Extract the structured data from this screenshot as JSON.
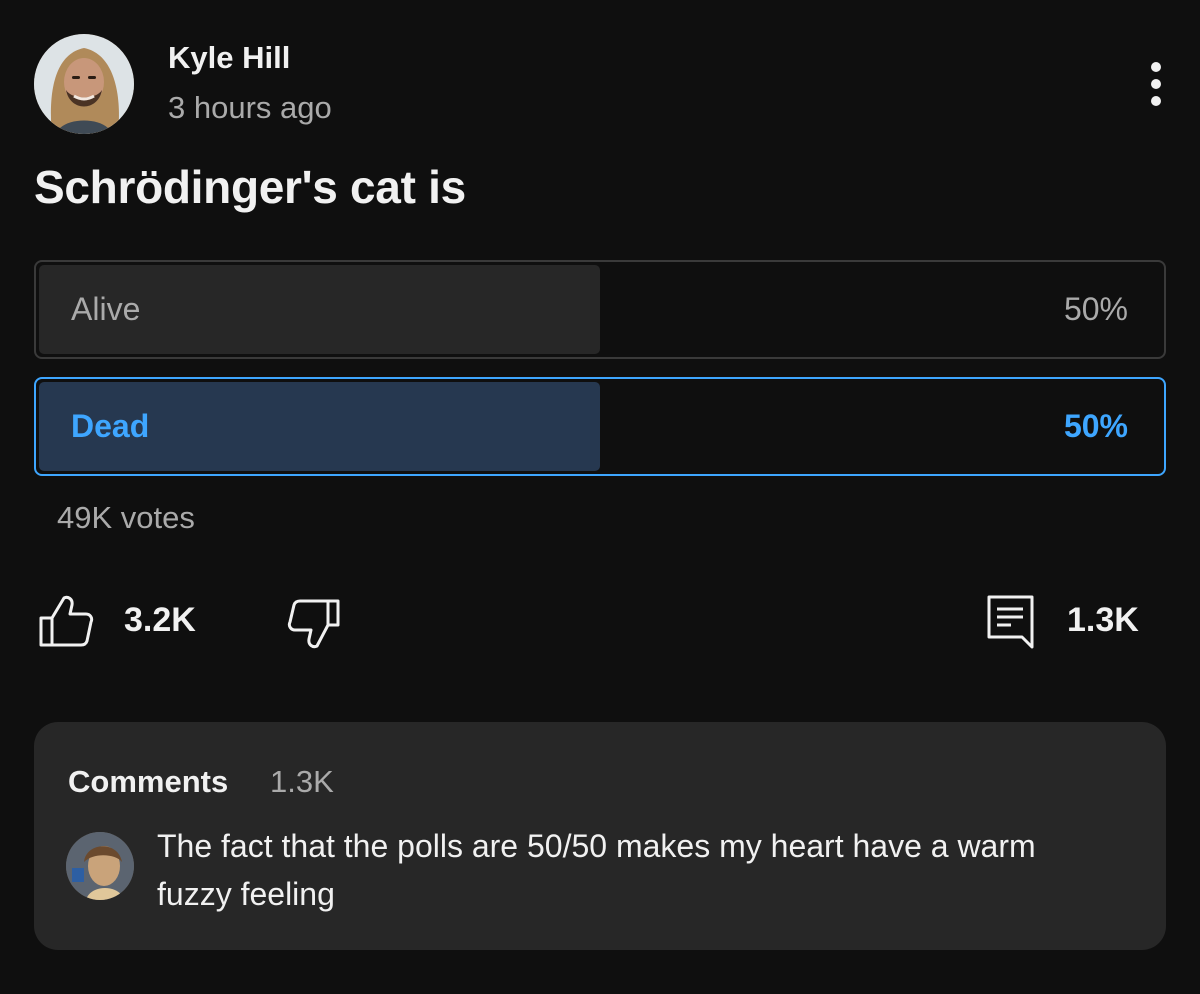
{
  "post": {
    "author": "Kyle Hill",
    "time": "3 hours ago",
    "question": "Schrödinger's cat is"
  },
  "poll": {
    "options": [
      {
        "label": "Alive",
        "percent_text": "50%",
        "fraction": 0.5,
        "selected": false
      },
      {
        "label": "Dead",
        "percent_text": "50%",
        "fraction": 0.5,
        "selected": true
      }
    ],
    "votes": "49K votes"
  },
  "actions": {
    "likes": "3.2K",
    "comments": "1.3K"
  },
  "comments": {
    "title": "Comments",
    "count": "1.3K",
    "top_comment": "The fact that the polls are 50/50 makes my heart have a warm fuzzy feeling"
  },
  "icons": {
    "more": "more-vert-icon",
    "like": "thumbs-up-icon",
    "dislike": "thumbs-down-icon",
    "comment": "comment-icon"
  },
  "colors": {
    "background": "#0f0f0f",
    "accent": "#3ea6ff",
    "selected_fill": "#263850",
    "card": "#272727",
    "secondary_text": "#aaaaaa"
  }
}
